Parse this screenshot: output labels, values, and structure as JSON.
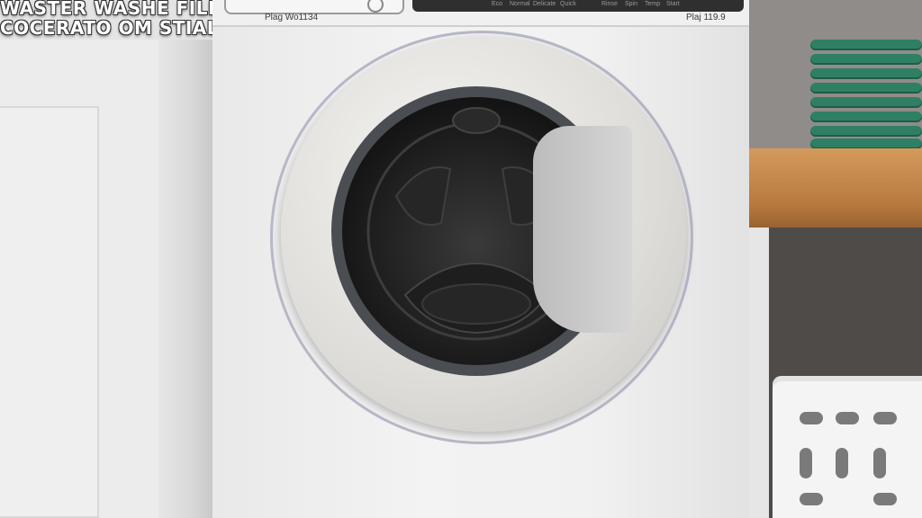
{
  "overlay_caption": {
    "line1": "WASTER WASHE FILL",
    "line2": "COCERATO OM STIAL"
  },
  "washer": {
    "model_left": "Plag Wo1134",
    "model_right": "Plaj 119.9",
    "display_labels": [
      "Eco",
      "Normal",
      "Delicate",
      "Quick",
      "Rinse",
      "Spin",
      "Temp",
      "Start"
    ]
  },
  "colors": {
    "shelf_wood": "#c48648",
    "plates": "#2f7f64",
    "washer_body": "#f1f1f1",
    "door_ring": "#dedcd8",
    "drum_glass": "#151515"
  }
}
